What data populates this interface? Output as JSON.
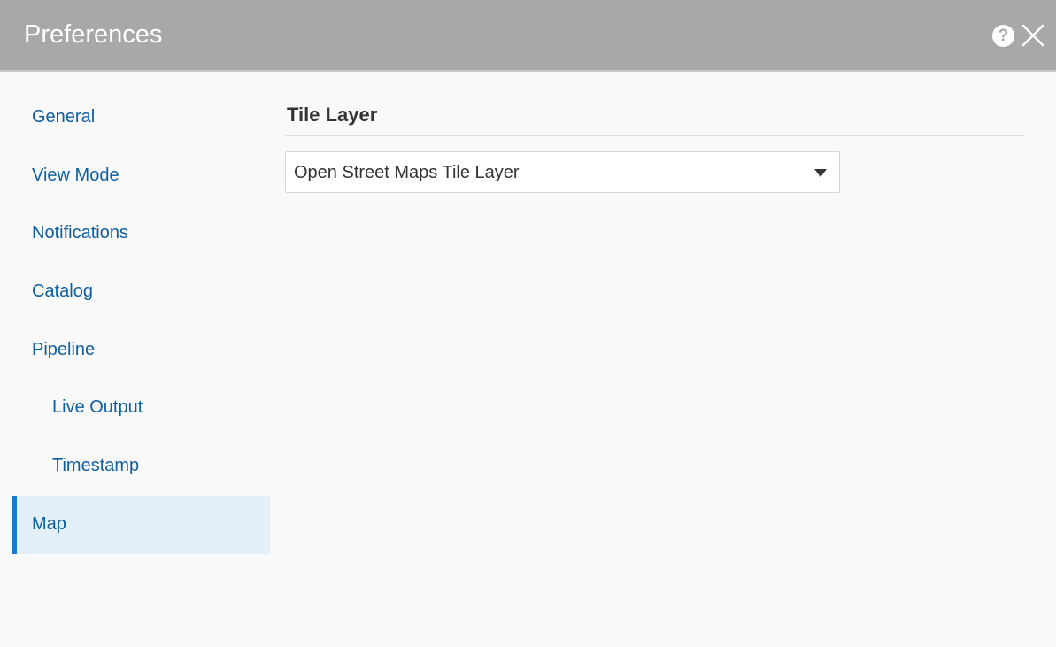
{
  "window": {
    "title": "Preferences",
    "help_glyph": "?",
    "help_icon": "help-circle-icon",
    "close_icon": "close-x-icon"
  },
  "sidebar": {
    "items": [
      {
        "label": "General",
        "level": 0,
        "active": false
      },
      {
        "label": "View Mode",
        "level": 0,
        "active": false
      },
      {
        "label": "Notifications",
        "level": 0,
        "active": false
      },
      {
        "label": "Catalog",
        "level": 0,
        "active": false
      },
      {
        "label": "Pipeline",
        "level": 0,
        "active": false
      },
      {
        "label": "Live Output",
        "level": 1,
        "active": false
      },
      {
        "label": "Timestamp",
        "level": 1,
        "active": false
      },
      {
        "label": "Map",
        "level": 0,
        "active": true
      }
    ]
  },
  "main": {
    "section_title": "Tile Layer",
    "tile_layer_select": {
      "selected": "Open Street Maps Tile Layer",
      "icon": "caret-down-icon"
    }
  },
  "colors": {
    "titlebar": "#a8a8a8",
    "link": "#0e5fa0",
    "active_bg": "#e3f0fa",
    "active_accent": "#1a79d2"
  }
}
